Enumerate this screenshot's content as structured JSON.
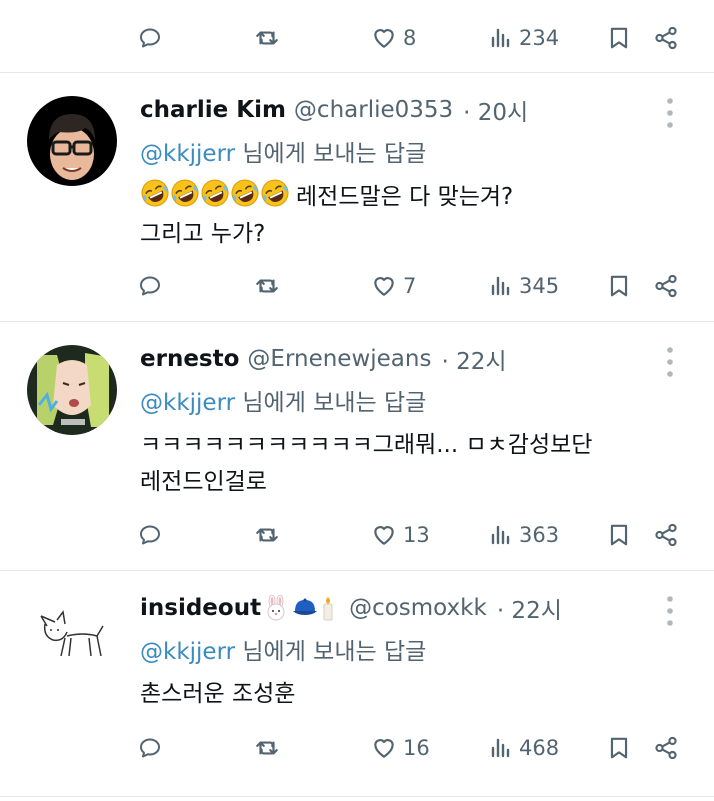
{
  "top_actions": {
    "likes": "8",
    "views": "234"
  },
  "replies": [
    {
      "display_name": "charlie Kim",
      "handle": "@charlie0353",
      "time": "· 20시",
      "reply_to_mention": "@kkjjerr",
      "reply_to_suffix": " 님에게 보내는 답글",
      "emoji": [
        "rolling-on-floor-laughing",
        "rolling-on-floor-laughing",
        "rolling-on-floor-laughing",
        "rolling-on-floor-laughing",
        "rolling-on-floor-laughing"
      ],
      "text_line1": "레전드말은 다 맞는겨?",
      "text_line2": "그리고 누가?",
      "likes": "7",
      "views": "345"
    },
    {
      "display_name": "ernesto",
      "handle": "@Ernenewjeans",
      "time": "· 22시",
      "reply_to_mention": "@kkjjerr",
      "reply_to_suffix": " 님에게 보내는 답글",
      "text_line1": "ㅋㅋㅋㅋㅋㅋㅋㅋㅋㅋㅋ그래뭐... ㅁㅊ감성보단",
      "text_line2": "레전드인걸로",
      "likes": "13",
      "views": "363"
    },
    {
      "display_name": "insideout",
      "handle": "@cosmoxkk",
      "time": "· 22시",
      "name_emoji": [
        "rabbit-face",
        "blue-cap",
        "candle"
      ],
      "reply_to_mention": "@kkjjerr",
      "reply_to_suffix": " 님에게 보내는 답글",
      "text_line1": "촌스러운 조성훈",
      "likes": "16",
      "views": "468"
    }
  ],
  "colors": {
    "icon_gray": "#536471",
    "mention_blue": "#3a8bbf",
    "divider": "#e6e9ec"
  }
}
